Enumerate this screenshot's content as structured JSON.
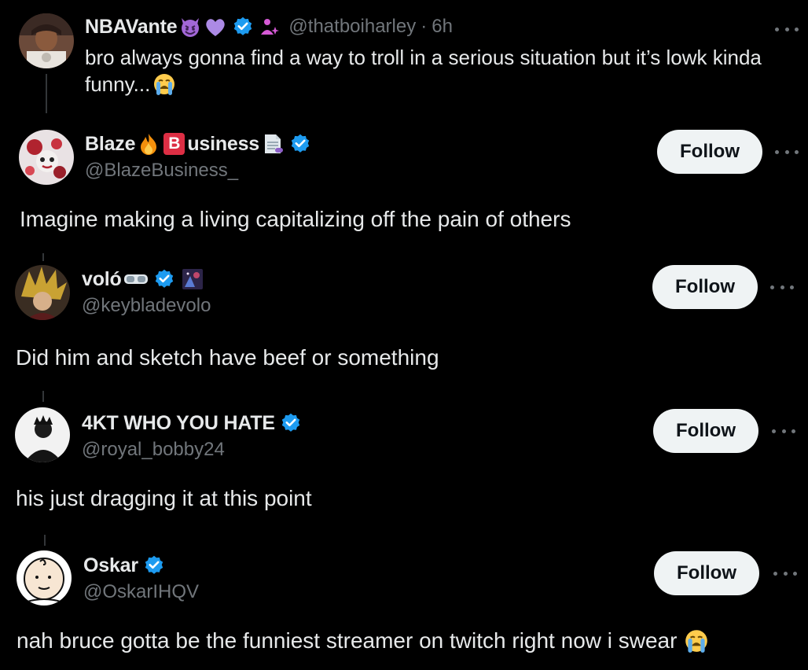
{
  "parent_post": {
    "display_name": "NBAVante",
    "handle": "@thatboiharley",
    "separator": "·",
    "time": "6h",
    "text_line1": "bro always gonna find a way to troll in a serious situation but it’s lowk kinda",
    "text_line2": "funny...",
    "emojis": [
      "smiling-imp-icon",
      "purple-heart-icon",
      "person-sparkle-icon",
      "loudly-crying-icon"
    ]
  },
  "replies": [
    {
      "display_name_part1": "Blaze",
      "badge_letter": "B",
      "display_name_part2": "usiness",
      "handle": "@BlazeBusiness_",
      "text": "Imagine making a living capitalizing off the pain of others",
      "follow_label": "Follow"
    },
    {
      "display_name": "voló",
      "handle": "@keybladevolo",
      "text": "Did him and sketch have beef or something",
      "follow_label": "Follow"
    },
    {
      "display_name": "4KT WHO YOU HATE",
      "handle": "@royal_bobby24",
      "text": "his just dragging it at this point",
      "follow_label": "Follow"
    },
    {
      "display_name": "Oskar",
      "handle": "@OskarIHQV",
      "text": "nah bruce gotta be the funniest streamer on twitch right now i swear",
      "follow_label": "Follow"
    }
  ],
  "colors": {
    "background": "#000000",
    "primary_text": "#e7e9ea",
    "secondary_text": "#71767b",
    "verified_blue": "#1d9bf0",
    "follow_bg": "#eff3f4",
    "follow_text": "#0f1419"
  }
}
